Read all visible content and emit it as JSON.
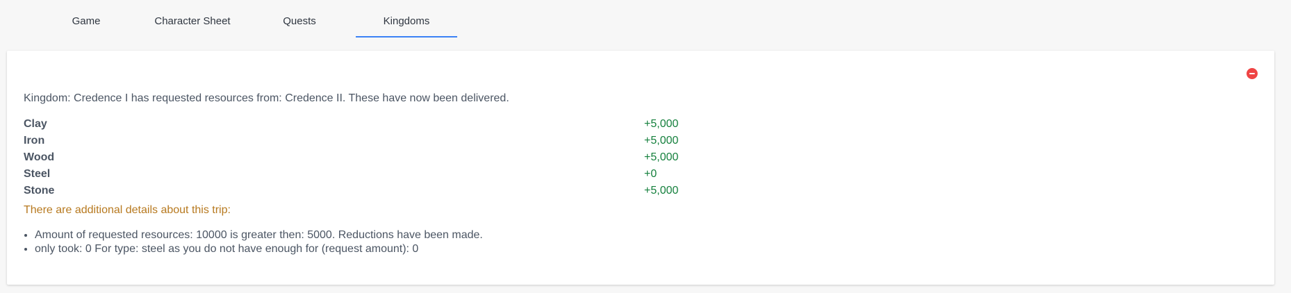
{
  "tabs": [
    {
      "label": "Game",
      "active": false
    },
    {
      "label": "Character Sheet",
      "active": false
    },
    {
      "label": "Quests",
      "active": false
    },
    {
      "label": "Kingdoms",
      "active": true
    }
  ],
  "panel": {
    "close_icon": "minus-circle-icon",
    "close_color": "#ef4444",
    "message": "Kingdom: Credence I has requested resources from: Credence II. These have now been delivered.",
    "resources": [
      {
        "name": "Clay",
        "value": "+5,000"
      },
      {
        "name": "Iron",
        "value": "+5,000"
      },
      {
        "name": "Wood",
        "value": "+5,000"
      },
      {
        "name": "Steel",
        "value": "+0"
      },
      {
        "name": "Stone",
        "value": "+5,000"
      }
    ],
    "details_title": "There are additional details about this trip:",
    "details": [
      "Amount of requested resources: 10000 is greater then: 5000. Reductions have been made.",
      "only took: 0 For type: steel as you do not have enough for (request amount): 0"
    ]
  },
  "colors": {
    "active_tab_underline": "#3b82f6",
    "positive_value": "#15803d",
    "details_title": "#b7791f"
  }
}
